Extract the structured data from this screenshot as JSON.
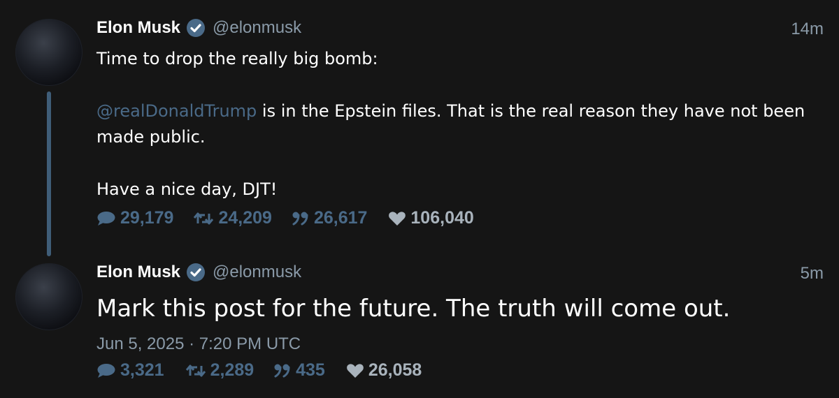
{
  "tweets": [
    {
      "author": {
        "name": "Elon Musk",
        "handle": "@elonmusk",
        "verified": true
      },
      "time": "14m",
      "body": {
        "line1": "Time to drop the really big bomb:",
        "mention": "@realDonaldTrump",
        "line2_rest": " is in the Epstein files. That is the real reason they have not been made public.",
        "line3": "Have a nice day, DJT!"
      },
      "stats": {
        "replies": "29,179",
        "retweets": "24,209",
        "quotes": "26,617",
        "likes": "106,040"
      }
    },
    {
      "author": {
        "name": "Elon Musk",
        "handle": "@elonmusk",
        "verified": true
      },
      "time": "5m",
      "body": {
        "text": "Mark this post for the future. The truth will come out."
      },
      "date": "Jun 5, 2025 · 7:20 PM UTC",
      "stats": {
        "replies": "3,321",
        "retweets": "2,289",
        "quotes": "435",
        "likes": "26,058"
      }
    }
  ],
  "colors": {
    "background": "#151515",
    "accent": "#4a6a88",
    "muted_text": "#8a9aa8",
    "thread_line": "#3f5d78",
    "verified_badge": "#4a6a88"
  },
  "icons": {
    "reply": "speech-bubble-icon",
    "retweet": "retweet-arrows-icon",
    "quote": "quote-marks-icon",
    "like": "heart-icon",
    "verified": "verified-check-icon"
  }
}
